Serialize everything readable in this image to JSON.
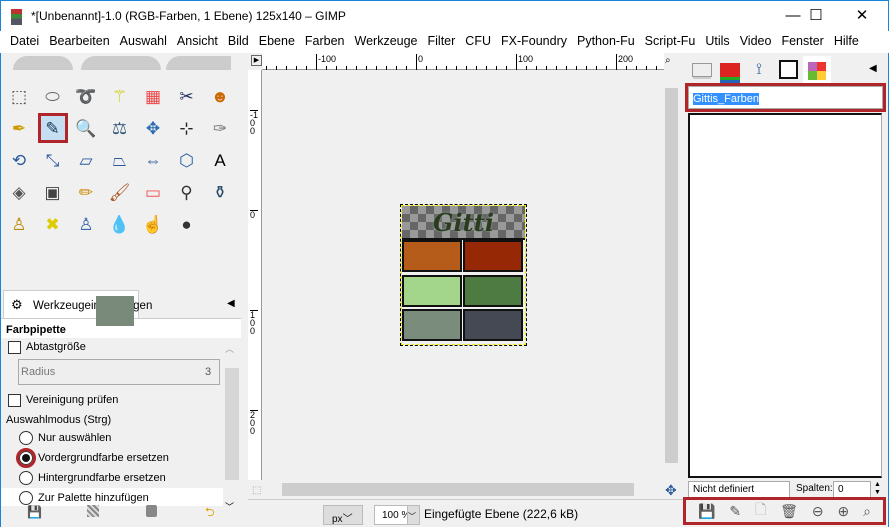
{
  "window": {
    "title": "*[Unbenannt]-1.0 (RGB-Farben, 1 Ebene) 125x140 – GIMP",
    "minimize": "—",
    "maximize": "☐",
    "close": "✕"
  },
  "menu": [
    "Datei",
    "Bearbeiten",
    "Auswahl",
    "Ansicht",
    "Bild",
    "Ebene",
    "Farben",
    "Werkzeuge",
    "Filter",
    "CFU",
    "FX-Foundry",
    "Python-Fu",
    "Script-Fu",
    "Utils",
    "Video",
    "Fenster",
    "Hilfe"
  ],
  "tools": [
    {
      "name": "rect-select",
      "g": "⬚",
      "c": "#444"
    },
    {
      "name": "ellipse-select",
      "g": "⬭",
      "c": "#666"
    },
    {
      "name": "lasso",
      "g": "➰",
      "c": "#777"
    },
    {
      "name": "fuzzy-select",
      "g": "⚚",
      "c": "#cc0"
    },
    {
      "name": "select-by-color",
      "g": "▦",
      "c": "#e44"
    },
    {
      "name": "scissors",
      "g": "✂",
      "c": "#236"
    },
    {
      "name": "foreground-select",
      "g": "☻",
      "c": "#c60"
    },
    {
      "name": "paths",
      "g": "✒",
      "c": "#c90"
    },
    {
      "name": "color-picker",
      "g": "✎",
      "c": "#135"
    },
    {
      "name": "zoom",
      "g": "🔍",
      "c": "#569"
    },
    {
      "name": "measure",
      "g": "⚖",
      "c": "#357"
    },
    {
      "name": "move",
      "g": "✥",
      "c": "#2a6ab0"
    },
    {
      "name": "align",
      "g": "⊹",
      "c": "#222"
    },
    {
      "name": "crop",
      "g": "✑",
      "c": "#777"
    },
    {
      "name": "rotate",
      "g": "⟲",
      "c": "#2a5a9a"
    },
    {
      "name": "scale",
      "g": "⤡",
      "c": "#2a5a9a"
    },
    {
      "name": "shear",
      "g": "▱",
      "c": "#2a5a9a"
    },
    {
      "name": "perspective",
      "g": "⏢",
      "c": "#2a5a9a"
    },
    {
      "name": "flip",
      "g": "⇔",
      "c": "#2a5a9a"
    },
    {
      "name": "cage",
      "g": "⬡",
      "c": "#2a5a9a"
    },
    {
      "name": "text",
      "g": "A",
      "c": "#000"
    },
    {
      "name": "bucket-fill",
      "g": "◈",
      "c": "#555"
    },
    {
      "name": "blend",
      "g": "▣",
      "c": "#444"
    },
    {
      "name": "pencil",
      "g": "✏",
      "c": "#c80"
    },
    {
      "name": "paintbrush",
      "g": "🖌",
      "c": "#a52"
    },
    {
      "name": "eraser",
      "g": "▭",
      "c": "#e55"
    },
    {
      "name": "airbrush",
      "g": "⚲",
      "c": "#333"
    },
    {
      "name": "ink",
      "g": "⚱",
      "c": "#246"
    },
    {
      "name": "clone",
      "g": "♙",
      "c": "#b80"
    },
    {
      "name": "heal",
      "g": "✖",
      "c": "#dc0"
    },
    {
      "name": "perspective-clone",
      "g": "♙",
      "c": "#36a"
    },
    {
      "name": "blur",
      "g": "💧",
      "c": "#58b"
    },
    {
      "name": "smudge",
      "g": "☝",
      "c": "#c74"
    },
    {
      "name": "dodge-burn",
      "g": "●",
      "c": "#333"
    }
  ],
  "colors": {
    "foreground": "#7a8a7a",
    "background": "#6b7280",
    "accent": "#b0252a"
  },
  "tool_options": {
    "tab": "Werkzeugeinstellungen",
    "tool_name": "Farbpipette",
    "sample_size": "Abtastgröße",
    "radius_label": "Radius",
    "radius_value": "3",
    "sample_merged": "Vereinigung prüfen",
    "mode_label": "Auswahlmodus (Strg)",
    "modes": [
      "Nur auswählen",
      "Vordergrundfarbe ersetzen",
      "Hintergrundfarbe ersetzen",
      "Zur Palette hinzufügen"
    ],
    "selected_mode": 1
  },
  "ruler": {
    "h": [
      "-100",
      "0",
      "100",
      "200"
    ],
    "v": [
      "-100",
      "0",
      "100",
      "200"
    ]
  },
  "image": {
    "text": "Gitti",
    "swatches": [
      "#b55c1a",
      "#962805",
      "#a3d58a",
      "#4e7b41",
      "#7a8c7c",
      "#444954"
    ]
  },
  "status": {
    "unit": "px",
    "zoom": "100 %",
    "message": "Eingefügte Ebene (222,6 kB)"
  },
  "palette": {
    "name": "Gittis_Farben",
    "color_name": "Nicht definiert",
    "columns_label": "Spalten:",
    "columns_value": "0"
  }
}
